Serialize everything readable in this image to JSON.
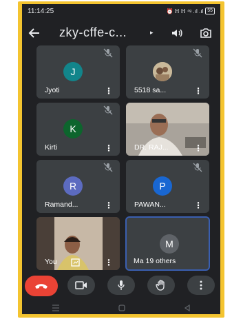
{
  "status_bar": {
    "time": "11:14:25",
    "indicators": "⏰ ℍ ℍ ⁴ᵍ .ıl .ıl",
    "battery": "55"
  },
  "header": {
    "title": "zky-cffe-c...",
    "caret": "▸"
  },
  "participants": [
    {
      "name": "Jyoti",
      "initial": "J",
      "avatar_color": "#12858b",
      "muted": true
    },
    {
      "name": "5518 sa...",
      "initial": "",
      "avatar_color": "#8b7a5c",
      "muted": true
    },
    {
      "name": "Kirti",
      "initial": "K",
      "avatar_color": "#0d652d",
      "muted": true
    },
    {
      "name": "DR. RAJ...",
      "initial": "",
      "avatar_color": "#8a8580",
      "muted": false
    },
    {
      "name": "Ramand...",
      "initial": "R",
      "avatar_color": "#5c6bc0",
      "muted": true
    },
    {
      "name": "PAWAN...",
      "initial": "P",
      "avatar_color": "#1967d2",
      "muted": true
    },
    {
      "name": "You",
      "initial": "",
      "avatar_color": "#7d6a5a",
      "muted": false
    },
    {
      "name": "Ma 19 others",
      "initial": "M",
      "avatar_color": "#5f6368",
      "muted": false
    }
  ],
  "more_glyph": "⋮",
  "colors": {
    "background": "#202124",
    "tile": "#3c4043",
    "end_call": "#ea4335",
    "frame": "#f4c430",
    "selected_border": "#3a5fb0"
  },
  "icons": [
    "back-arrow-icon",
    "speaker-icon",
    "camera-switch-icon",
    "mic-off-icon",
    "more-vert-icon",
    "end-call-icon",
    "video-icon",
    "mic-icon",
    "raise-hand-icon",
    "menu-icon",
    "home-icon",
    "back-icon"
  ]
}
